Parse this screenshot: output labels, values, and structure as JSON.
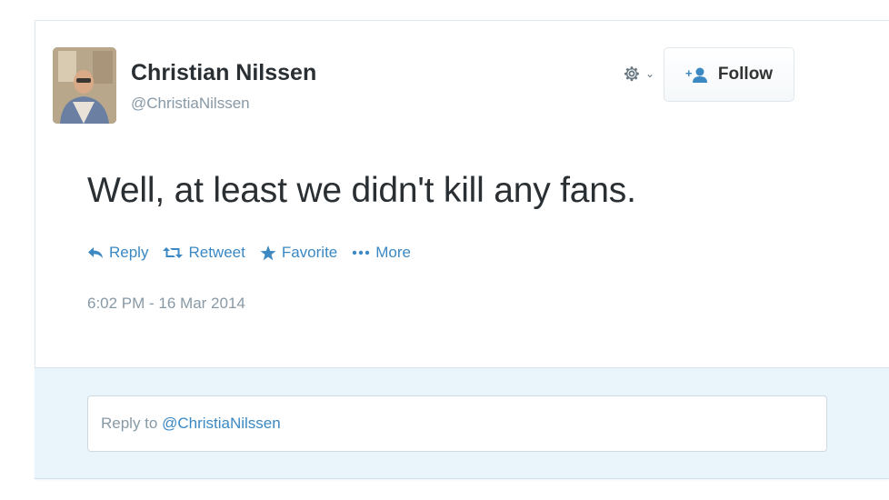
{
  "tweet": {
    "author_name": "Christian Nilssen",
    "author_handle": "@ChristiaNilssen",
    "text": "Well, at least we didn't kill any fans.",
    "timestamp": "6:02 PM - 16 Mar 2014"
  },
  "header": {
    "follow_label": "Follow",
    "settings_icon": "gear-icon"
  },
  "actions": {
    "reply_label": "Reply",
    "retweet_label": "Retweet",
    "favorite_label": "Favorite",
    "more_label": "More"
  },
  "reply_box": {
    "prefix": "Reply to ",
    "mention": "@ChristiaNilssen"
  },
  "colors": {
    "link": "#3b88c3",
    "muted": "#8899a6",
    "text": "#292f33",
    "reply_bg": "#eaf4fb"
  }
}
